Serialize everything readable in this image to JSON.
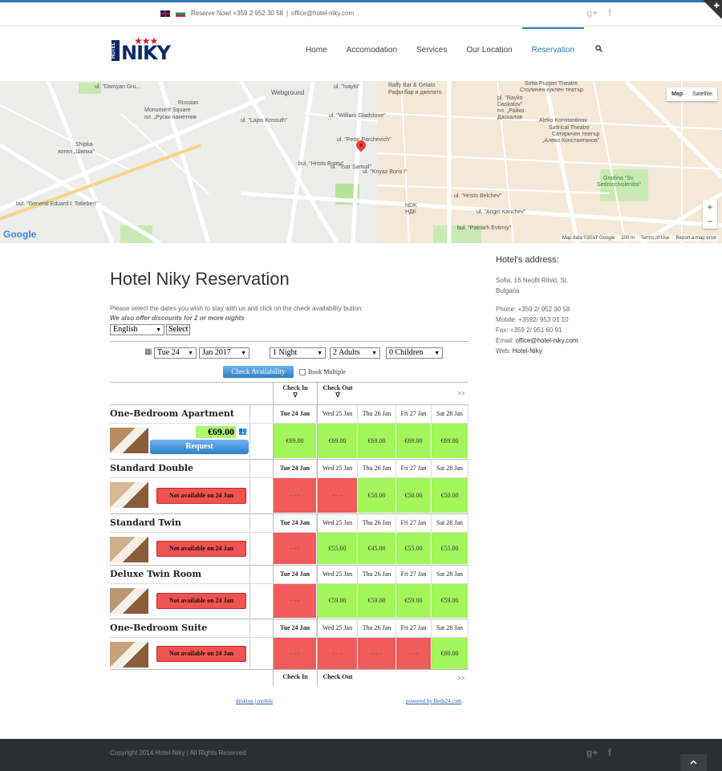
{
  "topbar": {
    "reserve": "Reserve Now! +359 2 952 30 58",
    "separator": "|",
    "email": "office@hotel-niky.com",
    "gplus": "g+",
    "facebook": "f"
  },
  "logo": {
    "hotel": "HOTEL",
    "name": "NIKY",
    "stars": "★★★"
  },
  "nav": {
    "items": [
      "Home",
      "Accomodation",
      "Services",
      "Our Location",
      "Reservation"
    ],
    "active": "Reservation"
  },
  "map": {
    "type_map": "Map",
    "type_satellite": "Satellite",
    "zoom_in": "+",
    "zoom_out": "−",
    "google": "Google",
    "footer": [
      "Map data ©2017 Google",
      "100 m",
      "Terms of Use",
      "Report a map error"
    ],
    "labels": {
      "l1": "ul. \"Damyan Gru...",
      "l2": "Russian",
      "l3": "Monument Square",
      "l4": "пл. „Руски паметник",
      "l5": "Webground",
      "l6": "ul. \"Lajos Kossuth\"",
      "l7": "Shipka",
      "l8": "хотел „Шипка\"",
      "l9": "ul. \"William Gladstone\"",
      "l10": "ul. \"Petar Parchevich\"",
      "l11": "Raffy Bar & Gelato",
      "l12": "Рафи бар и джелато",
      "l13": "Sofia Puppet Theatre",
      "l14": "Столичен куклен театър",
      "l15": "pl. \"Rayko",
      "l16": "Daskalov\"",
      "l17": "пл. „Райко",
      "l18": "Даскалов",
      "l19": "Aleko Konstantinov",
      "l20": "Satirical Theatre",
      "l21": "Сатиричен театър",
      "l22": "„Алеко Константинов\"",
      "l23": "bul. \"Hristo Botev\"",
      "l24": "ul. \"Tsar Samuil\"",
      "l25": "ul. \"Knyaz Boris I\"",
      "l26": "NDK",
      "l27": "НДК",
      "l28": "ul. \"Hristo Belchev\"",
      "l29": "ul. \"Angel Kanchev\"",
      "l30": "bul. \"Patriarh Evtimiy\"",
      "l31": "Gradina \"Sv.",
      "l32": "Sedmochislenitsi\"",
      "l33": "bul. \"General Eduard I. Totleben\"",
      "l34": "ul. \"Ivaylo\""
    }
  },
  "reservation": {
    "title": "Hotel Niky Reservation",
    "intro": "Please select the dates you wish to stay with us and click on the check availability button:",
    "discount": "We also offer discounts for 2 or more nights",
    "language": "English",
    "select_btn": "Select",
    "day": "Tue 24",
    "month": "Jan 2017",
    "nights": "1 Night",
    "adults": "2 Adults",
    "children": "0 Children",
    "check_btn": "Check Availability",
    "book_multiple": "Book Multiple",
    "check_in": "Check In",
    "check_out": "Check Out",
    "arrow_down": "∇",
    "next": ">>",
    "dates": [
      "Tue 24 Jan",
      "Wed 25 Jan",
      "Thu 26 Jan",
      "Fri 27 Jan",
      "Sat 28 Jan"
    ],
    "rooms": [
      {
        "name": "One-Bedroom Apartment",
        "price": "€69.00",
        "action": "Request",
        "cells": [
          [
            "g",
            "€69.00"
          ],
          [
            "g",
            "€69.00"
          ],
          [
            "g",
            "€69.00"
          ],
          [
            "g",
            "€69.00"
          ],
          [
            "g",
            "€69.00"
          ]
        ]
      },
      {
        "name": "Standard Double",
        "action": "Not available on 24 Jan",
        "cells": [
          [
            "r",
            "- - -"
          ],
          [
            "r",
            "- - -"
          ],
          [
            "g",
            "€50.00"
          ],
          [
            "g",
            "€50.00"
          ],
          [
            "g",
            "€50.00"
          ]
        ]
      },
      {
        "name": "Standard Twin",
        "action": "Not available on 24 Jan",
        "cells": [
          [
            "r",
            "- - -"
          ],
          [
            "g",
            "€55.00"
          ],
          [
            "g",
            "€45.00"
          ],
          [
            "g",
            "€55.00"
          ],
          [
            "g",
            "€55.00"
          ]
        ]
      },
      {
        "name": "Deluxe Twin Room",
        "action": "Not available on 24 Jan",
        "cells": [
          [
            "r",
            "- - -"
          ],
          [
            "g",
            "€59.00"
          ],
          [
            "g",
            "€59.00"
          ],
          [
            "g",
            "€59.00"
          ],
          [
            "g",
            "€59.00"
          ]
        ]
      },
      {
        "name": "One-Bedroom Suite",
        "action": "Not available on 24 Jan",
        "cells": [
          [
            "r",
            "- - -"
          ],
          [
            "r",
            "- - -"
          ],
          [
            "r",
            "- - -"
          ],
          [
            "r",
            "- - -"
          ],
          [
            "g",
            "€80.00"
          ]
        ]
      }
    ],
    "link_desktop": "desktop",
    "link_sep": "|",
    "link_mobile": "mobile",
    "powered": "powered by Beds24.com"
  },
  "sidebar": {
    "title": "Hotel's address:",
    "address1": "Sofia, 16 Neofit Rilski, St.",
    "address2": "Bulgaria",
    "phone": "Phone: +359 2/ 952 30 58",
    "mobile": "Mobile: +3592/ 953 01 10",
    "fax": "Fax: +359 2/ 951 60 91",
    "email_label": "Email: ",
    "email": "office@hotel-niky.com",
    "web_label": "Web: ",
    "web": "Hotel-Niky"
  },
  "footer": {
    "copyright": "Copyright 2014 Hotel-Niky | All Rights Reserved",
    "gplus": "g+",
    "facebook": "f",
    "to_top": "^"
  },
  "colors": {
    "accent": "#2a7ab8",
    "available": "#a2f65a",
    "unavailable": "#f15b5b",
    "footer": "#2b2e33"
  }
}
